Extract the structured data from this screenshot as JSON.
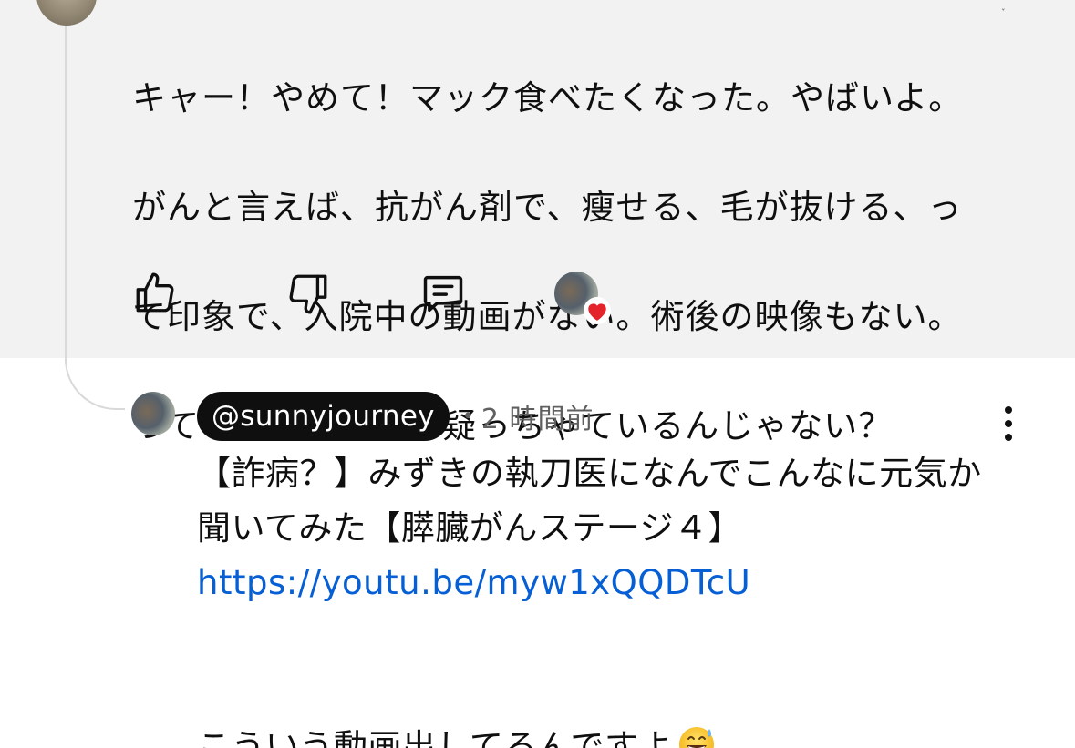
{
  "parent_comment": {
    "text_lines": [
      "キャー！やめて！マック食べたくなった。やばいよ。",
      "がんと言えば、抗がん剤で、瘦せる、毛が抜ける、っ",
      "て印象で、入院中の動画がない。術後の映像もない。",
      "っていう所でみんな疑っちゃているんじゃない？"
    ],
    "actions": {
      "like_icon": "thumbs-up-icon",
      "dislike_icon": "thumbs-down-icon",
      "reply_icon": "comment-reply-icon",
      "creator_heart_icon": "creator-heart-icon"
    }
  },
  "reply": {
    "handle": "@sunnyjourney",
    "separator": "•",
    "timestamp": "2 時間前",
    "more_icon": "more-vertical-icon",
    "body": {
      "line1": "【詐病？】みずきの執刀医になんでこんなに元気か",
      "line2": "聞いてみた【膵臓がんステージ４】",
      "link": "https://youtu.be/myw1xQQDTcU",
      "line4": "こういう動画出してるんですよ",
      "emoji": "grinning-face-with-sweat-emoji"
    }
  },
  "colors": {
    "highlight_bg": "#f2f2f2",
    "link": "#065fd4",
    "handle_pill_bg": "#0f0f0f",
    "heart": "#e3242b",
    "secondary_text": "#606060"
  }
}
